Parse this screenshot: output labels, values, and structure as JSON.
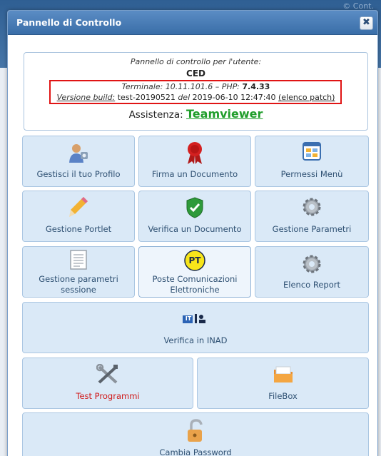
{
  "background": {
    "text": "© Cont."
  },
  "dialog": {
    "title": "Pannello di Controllo",
    "close_glyph": "✖"
  },
  "info": {
    "line1": "Pannello di controllo per l'utente:",
    "user": "CED",
    "terminal_label": "Terminale:",
    "terminal_value": "10.11.101.6",
    "sep": "–",
    "php_label": "PHP:",
    "php_value": "7.4.33",
    "build_label": "Versione build:",
    "build_value": "test-20190521",
    "del_label": "del",
    "build_date": "2019-06-10 12:47:40",
    "patch_link": "(elenco patch)",
    "assist_label": "Assistenza:",
    "assist_link": "Teamviewer"
  },
  "tiles": [
    {
      "label": "Gestisci il tuo Profilo",
      "icon": "user-profile-icon"
    },
    {
      "label": "Firma un Documento",
      "icon": "ribbon-seal-icon"
    },
    {
      "label": "Permessi Menù",
      "icon": "menu-window-icon"
    },
    {
      "label": "Gestione Portlet",
      "icon": "pencil-icon"
    },
    {
      "label": "Verifica un Documento",
      "icon": "shield-check-icon"
    },
    {
      "label": "Gestione Parametri",
      "icon": "gear-icon"
    },
    {
      "label": "Gestione parametri sessione",
      "icon": "document-icon"
    },
    {
      "label": "Poste Comunicazioni Elettroniche",
      "icon": "pt-badge-icon",
      "badge": "PT"
    },
    {
      "label": "Elenco Report",
      "icon": "gear-icon"
    },
    {
      "label": "Verifica in INAD",
      "icon": "inad-icon",
      "badge": "IT"
    },
    {
      "label": "Test Programmi",
      "icon": "tools-icon"
    },
    {
      "label": "FileBox",
      "icon": "folder-icon"
    },
    {
      "label": "Cambia Password",
      "icon": "padlock-icon"
    }
  ],
  "colors": {
    "tile_bg": "#dae9f7",
    "tile_text": "#2e5072",
    "title_bar": "#3a6ea8",
    "highlight_border": "#e01414",
    "teamviewer_link": "#1f9d2a",
    "test_programmi_text": "#d01818"
  }
}
